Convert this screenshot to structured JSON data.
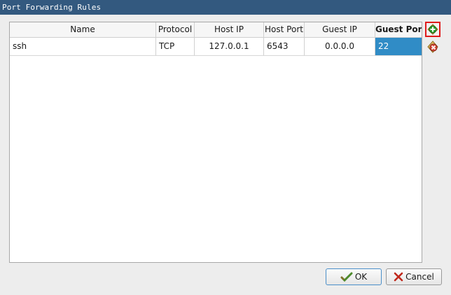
{
  "window": {
    "title": "Port Forwarding Rules"
  },
  "table": {
    "columns": [
      "Name",
      "Protocol",
      "Host IP",
      "Host Port",
      "Guest IP",
      "Guest Port"
    ],
    "rows": [
      [
        "ssh",
        "TCP",
        "127.0.0.1",
        "6543",
        "0.0.0.0",
        "22"
      ]
    ]
  },
  "side_buttons": {
    "add_icon": "add-rule-icon",
    "remove_icon": "remove-rule-icon"
  },
  "buttons": {
    "ok_label": "OK",
    "cancel_label": "Cancel"
  },
  "colors": {
    "titlebar": "#33597f",
    "selection": "#308cc6",
    "highlight": "#e01b1b"
  }
}
